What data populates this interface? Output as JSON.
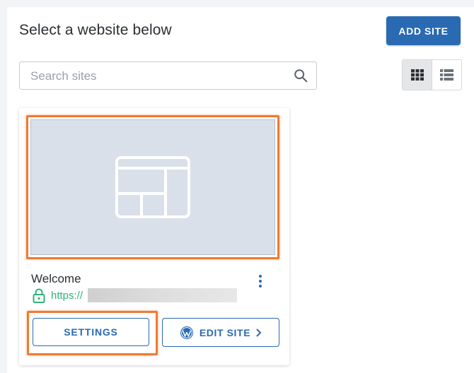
{
  "header": {
    "title": "Select a website below",
    "add_site_label": "ADD SITE"
  },
  "search": {
    "placeholder": "Search sites",
    "value": ""
  },
  "view_toggle": {
    "active": "grid"
  },
  "site_card": {
    "name": "Welcome",
    "url_prefix": "https://",
    "settings_label": "SETTINGS",
    "edit_site_label": "EDIT SITE"
  },
  "colors": {
    "primary": "#2a6ab3",
    "highlight": "#f07a32",
    "secure_green": "#2fb47a",
    "thumbnail_bg": "#d9e0ea"
  },
  "icons": {
    "search": "search-icon",
    "grid": "grid-view-icon",
    "list": "list-view-icon",
    "thumbnail": "layout-placeholder-icon",
    "menu": "kebab-menu-icon",
    "lock": "lock-icon",
    "wordpress": "wordpress-icon",
    "chevron": "chevron-right-icon"
  }
}
